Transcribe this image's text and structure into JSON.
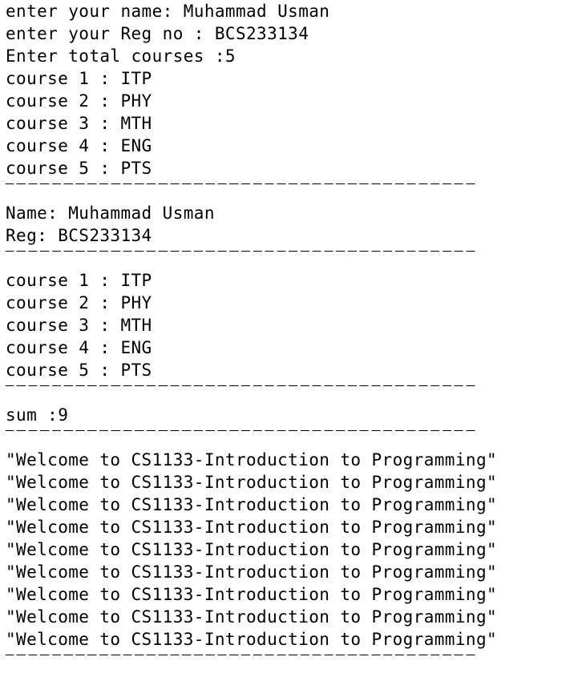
{
  "input_section": {
    "name_prompt": "enter your name: Muhammad Usman",
    "reg_prompt": "enter your Reg no : BCS233134",
    "total_courses_prompt": "Enter total courses :5",
    "courses": [
      "course 1 : ITP",
      "course 2 : PHY",
      "course 3 : MTH",
      "course 4 : ENG",
      "course 5 : PTS"
    ]
  },
  "details_section": {
    "name_line": "Name: Muhammad Usman",
    "reg_line": "Reg: BCS233134"
  },
  "courses_section": {
    "courses": [
      "course 1 : ITP",
      "course 2 : PHY",
      "course 3 : MTH",
      "course 4 : ENG",
      "course 5 : PTS"
    ]
  },
  "sum_section": {
    "sum_line": "sum :9"
  },
  "welcome_section": {
    "lines": [
      "\"Welcome to CS1133-Introduction to Programming\"",
      "\"Welcome to CS1133-Introduction to Programming\"",
      "\"Welcome to CS1133-Introduction to Programming\"",
      "\"Welcome to CS1133-Introduction to Programming\"",
      "\"Welcome to CS1133-Introduction to Programming\"",
      "\"Welcome to CS1133-Introduction to Programming\"",
      "\"Welcome to CS1133-Introduction to Programming\"",
      "\"Welcome to CS1133-Introduction to Programming\"",
      "\"Welcome to CS1133-Introduction to Programming\""
    ]
  }
}
